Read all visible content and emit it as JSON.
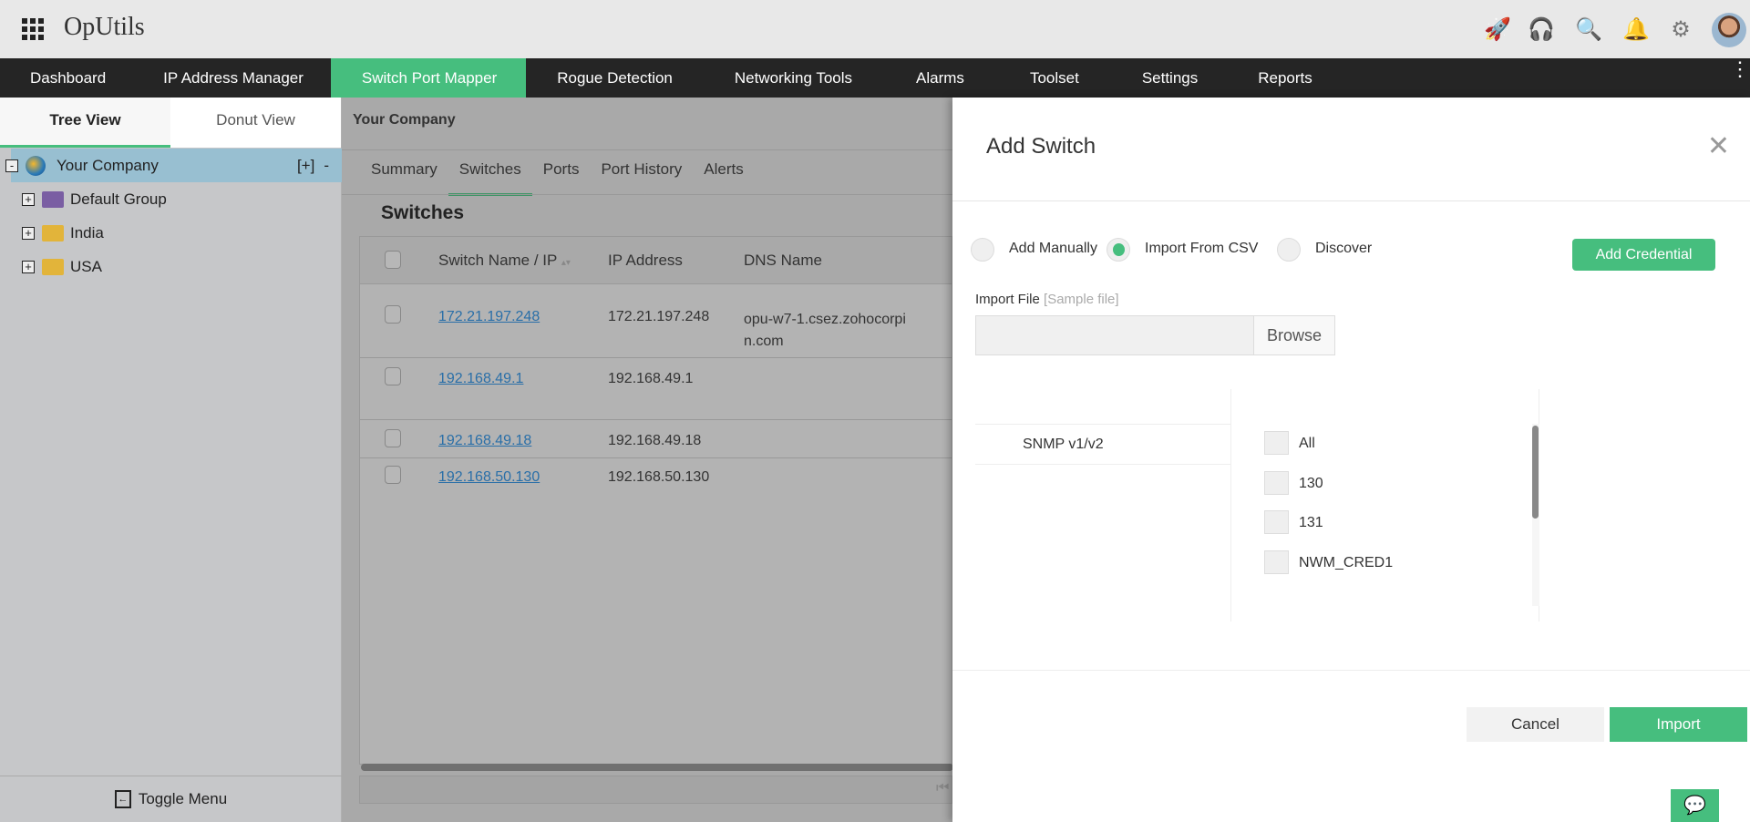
{
  "app": {
    "title": "OpUtils",
    "header_icons": [
      "rocket-icon",
      "headset-icon",
      "search-icon",
      "bell-icon",
      "gear-icon",
      "avatar"
    ]
  },
  "nav": {
    "items": [
      "Dashboard",
      "IP Address Manager",
      "Switch Port Mapper",
      "Rogue Detection",
      "Networking Tools",
      "Alarms",
      "Toolset",
      "Settings",
      "Reports"
    ],
    "active": "Switch Port Mapper"
  },
  "left": {
    "tabs": [
      "Tree View",
      "Donut View"
    ],
    "tree": {
      "root": "Your Company",
      "root_actions": "[+]",
      "root_collapse": "-",
      "children": [
        "Default Group",
        "India",
        "USA"
      ]
    },
    "toggle_menu": "Toggle Menu"
  },
  "main": {
    "breadcrumb": "Your Company",
    "tabs": [
      "Summary",
      "Switches",
      "Ports",
      "Port History",
      "Alerts"
    ],
    "active_tab": "Switches",
    "section_title": "Switches",
    "columns": [
      "Switch Name / IP",
      "IP Address",
      "DNS Name"
    ],
    "rows": [
      {
        "name": "172.21.197.248",
        "ip": "172.21.197.248",
        "dns": "opu-w7-1.csez.zohocorpin.com"
      },
      {
        "name": "192.168.49.1",
        "ip": "192.168.49.1",
        "dns": ""
      },
      {
        "name": "192.168.49.18",
        "ip": "192.168.49.18",
        "dns": ""
      },
      {
        "name": "192.168.50.130",
        "ip": "192.168.50.130",
        "dns": ""
      }
    ]
  },
  "modal": {
    "title": "Add Switch",
    "options": [
      "Add Manually",
      "Import From CSV",
      "Discover"
    ],
    "selected_option": "Import From CSV",
    "add_credential": "Add Credential",
    "import_label": "Import File",
    "sample_file": "[Sample file]",
    "file_value": "",
    "browse": "Browse",
    "credential_type": "SNMP v1/v2",
    "credentials": [
      "All",
      "130",
      "131",
      "NWM_CRED1"
    ],
    "cancel": "Cancel",
    "import": "Import"
  },
  "colors": {
    "accent": "#46be7e",
    "nav_bg": "#252525",
    "tree_selected": "#98bfd1",
    "link": "#2a6fa8"
  }
}
